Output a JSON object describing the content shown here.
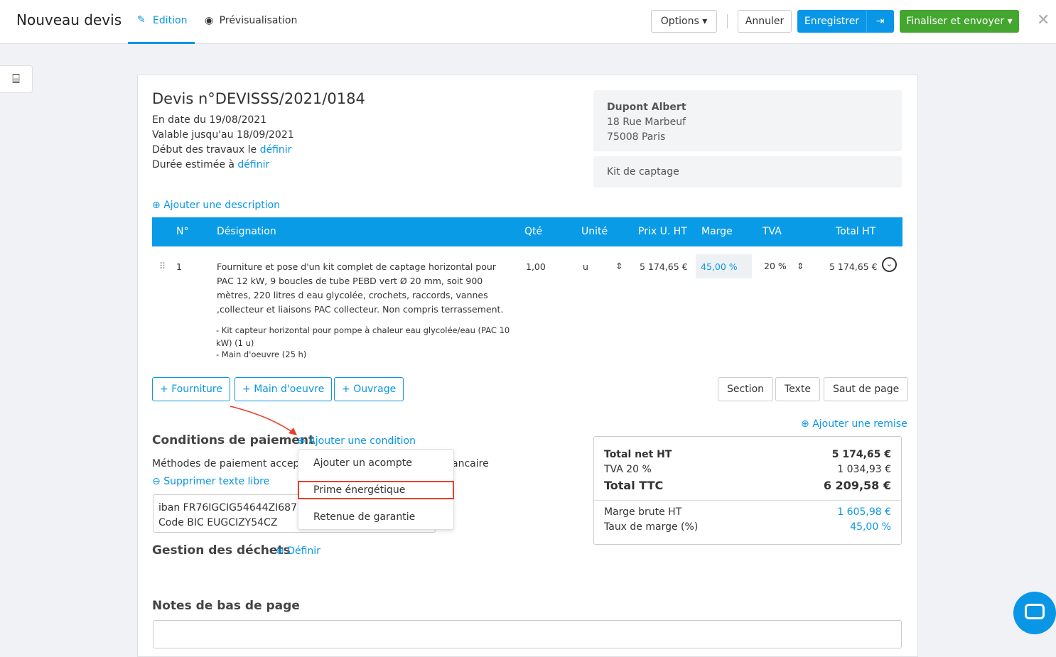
{
  "header": {
    "title": "Nouveau devis",
    "tabs": [
      {
        "label": "Edition",
        "active": true
      },
      {
        "label": "Prévisualisation"
      }
    ],
    "options": "Options",
    "cancel": "Annuler",
    "save": "Enregistrer",
    "finalize": "Finaliser et envoyer",
    "accent": "#0a96e6",
    "green": "#43a62f"
  },
  "quote": {
    "title": "Devis n°DEVISSS/2021/0184",
    "date": "En date du 19/08/2021",
    "valid": "Valable jusqu'au 18/09/2021",
    "start_label": "Début des travaux le",
    "start_link": "définir",
    "duration_label": "Durée estimée à",
    "duration_link": "définir",
    "add_description": "Ajouter une description"
  },
  "client": {
    "name": "Dupont Albert",
    "street": "18 Rue Marbeuf",
    "city": "75008 Paris",
    "subject": "Kit de captage"
  },
  "table": {
    "headers": [
      "N°",
      "Désignation",
      "Qté",
      "Unité",
      "Prix U. HT",
      "Marge",
      "TVA",
      "Total HT"
    ],
    "rows": [
      {
        "n": "1",
        "designation": "Fourniture et pose d'un kit complet de captage horizontal pour PAC 12 kW, 9 boucles de tube PEBD vert Ø 20 mm, soit 900 mètres, 220 litres d    eau glycolée, crochets, raccords, vannes ,collecteur et liaisons PAC collecteur. Non compris terrassement.",
        "detail1": "- Kit capteur horizontal pour pompe à chaleur eau glycolée/eau (PAC 10 kW) (1 u)",
        "detail2": "- Main d'oeuvre (25 h)",
        "qty": "1,00",
        "unit": "u",
        "price": "5 174,65 €",
        "margin": "45,00 %",
        "tva": "20 %",
        "total": "5 174,65 €"
      }
    ]
  },
  "add_buttons": [
    "Fourniture",
    "Main d'oeuvre",
    "Ouvrage"
  ],
  "extra_buttons": [
    "Section",
    "Texte",
    "Saut de page"
  ],
  "payment": {
    "title": "Conditions de paiement",
    "add_condition": "Ajouter une condition",
    "methods": "Méthodes de paiement accepté",
    "methods_tail": "ancaire",
    "remove_free_text": "Supprimer texte libre",
    "iban": "iban FR76IGCIG54644ZI6876ZC",
    "bic": "Code BIC EUGCIZY54CZ",
    "menu": [
      "Ajouter un acompte",
      "Prime énergétique",
      "Retenue de garantie"
    ]
  },
  "waste": {
    "title": "Gestion des déchets",
    "define": "Définir"
  },
  "footer_notes": "Notes de bas de page",
  "totals": {
    "add_discount": "Ajouter une remise",
    "net_label": "Total net HT",
    "net": "5 174,65 €",
    "tva_label": "TVA 20 %",
    "tva": "1 034,93 €",
    "ttc_label": "Total TTC",
    "ttc": "6 209,58 €",
    "margin_label": "Marge brute HT",
    "margin": "1 605,98 €",
    "rate_label": "Taux de marge (%)",
    "rate": "45,00 %"
  }
}
